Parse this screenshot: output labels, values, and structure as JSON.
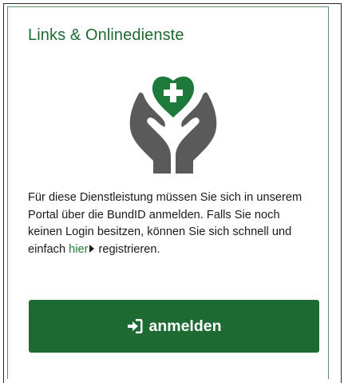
{
  "card": {
    "title": "Links & Onlinedienste",
    "illustration_icon": "caring-hands-heart-icon",
    "text_before_link": "Für diese Dienstleistung müssen Sie sich in unserem Portal über die BundID anmelden. Falls Sie noch keinen Login besitzen, können Sie sich schnell und einfach ",
    "link_label": "hier",
    "text_after_link": "registrieren.",
    "login_button_label": "anmelden",
    "login_button_icon": "sign-in-icon"
  },
  "colors": {
    "accent_green": "#1d6b33",
    "heart_green": "#1e7a3a",
    "hands_gray": "#5a5a5a",
    "title_green": "#1e6b33"
  }
}
